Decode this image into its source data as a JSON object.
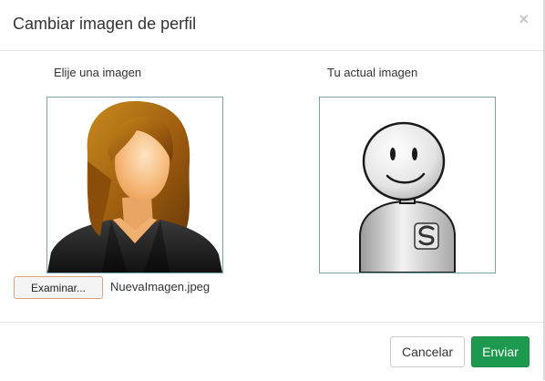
{
  "dialog": {
    "title": "Cambiar imagen de perfil",
    "close_label": "×"
  },
  "new_image": {
    "label": "Elije una imagen",
    "browse_button": "Examinar...",
    "file_name": "NuevaImagen.jpeg",
    "preview": "woman-silhouette-avatar"
  },
  "current_image": {
    "label": "Tu actual imagen",
    "preview": "smiling-robot-avatar"
  },
  "footer": {
    "cancel_label": "Cancelar",
    "send_label": "Enviar"
  },
  "colors": {
    "send_button": "#1e9a4e",
    "frame_border": "#7fa0ad",
    "browse_button_border": "#e0a080"
  }
}
